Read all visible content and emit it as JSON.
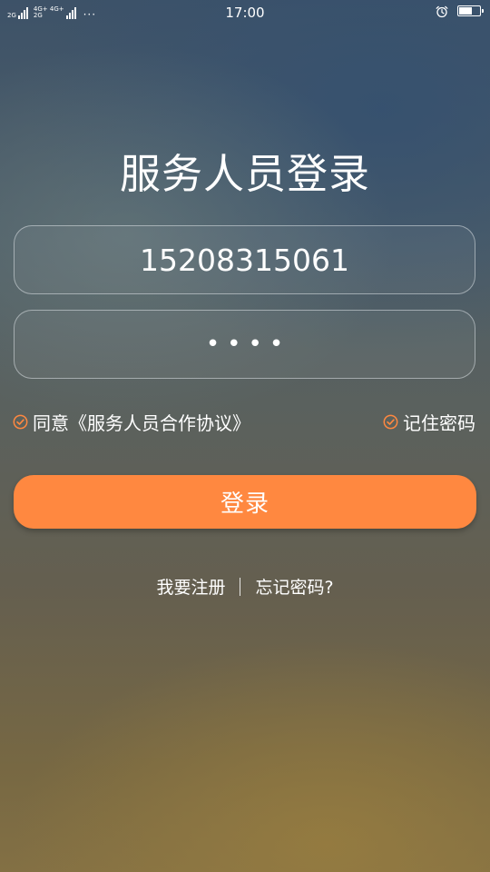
{
  "status_bar": {
    "time": "17:00",
    "network_1": "2G",
    "network_2_top": "4G+ 4G+",
    "network_2_bottom": "2G",
    "more": "···",
    "alarm_icon": "alarm-clock-icon",
    "battery_icon": "battery-icon",
    "battery_level": 0.65
  },
  "title": "服务人员登录",
  "form": {
    "phone_value": "15208315061",
    "password_value": "••••",
    "agree_label": "同意《服务人员合作协议》",
    "agree_checked": true,
    "remember_label": "记住密码",
    "remember_checked": true,
    "check_icon": "circle-check-icon",
    "login_label": "登录"
  },
  "links": {
    "register": "我要注册",
    "forgot": "忘记密码?"
  },
  "colors": {
    "accent": "#ff8840",
    "check": "#ff8840"
  }
}
